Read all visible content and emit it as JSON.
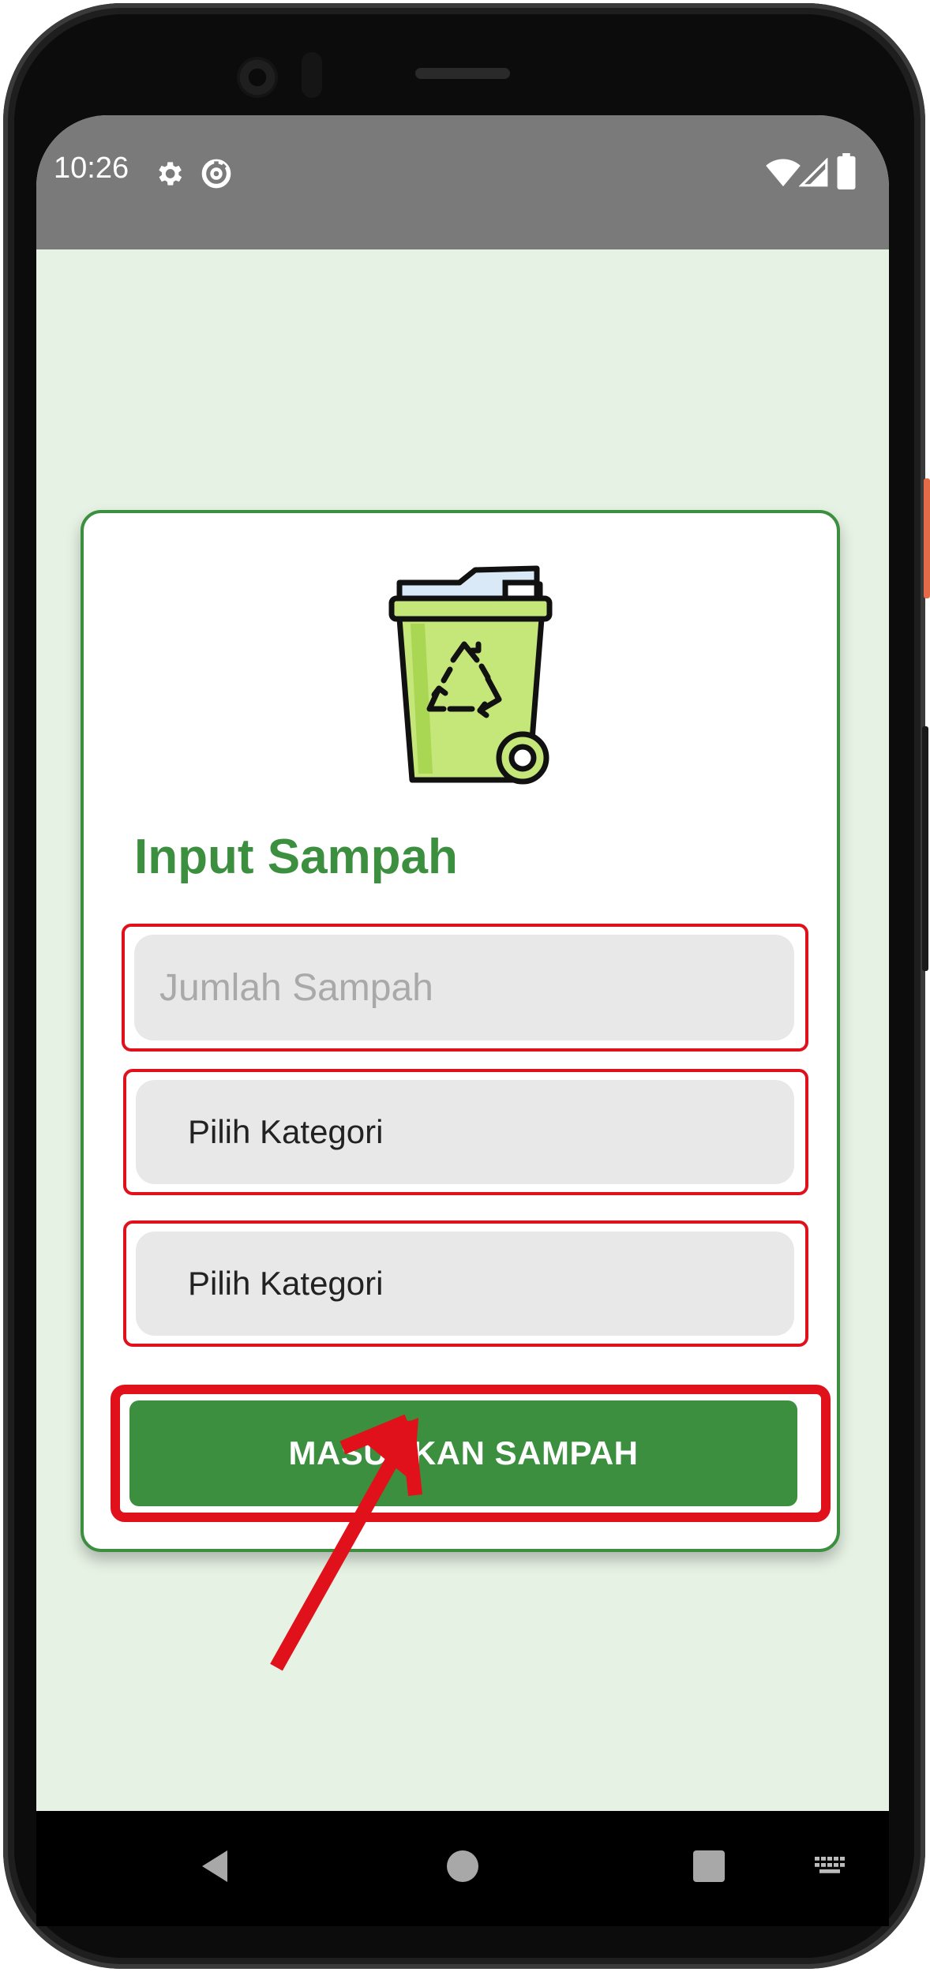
{
  "status_bar": {
    "time": "10:26",
    "icons": [
      "gear-icon",
      "data-saver-icon",
      "wifi-icon",
      "signal-icon",
      "battery-icon"
    ]
  },
  "form": {
    "title": "Input Sampah",
    "amount_placeholder": "Jumlah Sampah",
    "category_select_1": "Pilih Kategori",
    "category_select_2": "Pilih Kategori",
    "submit_label": "MASUKKAN SAMPAH"
  },
  "nav": {
    "icons": [
      "back-icon",
      "home-icon",
      "recents-icon",
      "keyboard-icon"
    ]
  },
  "colors": {
    "accent": "#3b8f3f",
    "background": "#e6f2e4",
    "highlight": "#e0111b",
    "field": "#e8e8e8"
  }
}
